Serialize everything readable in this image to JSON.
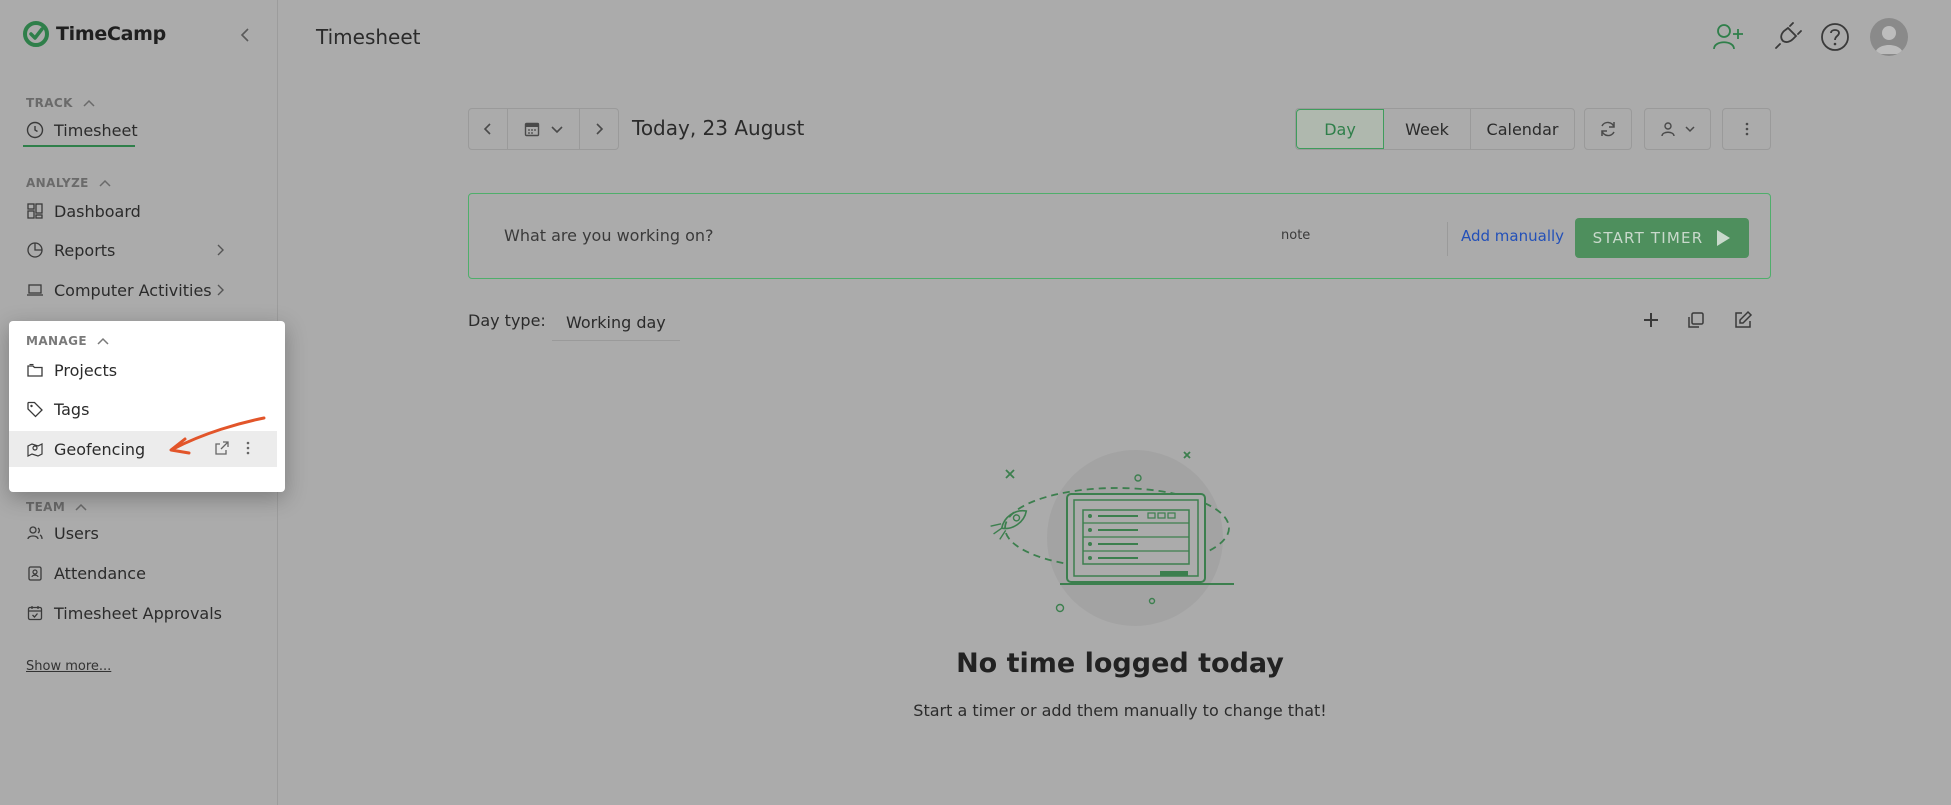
{
  "app": {
    "name": "TimeCamp"
  },
  "sidebar": {
    "track": {
      "label": "TRACK",
      "items": [
        {
          "label": "Timesheet"
        }
      ]
    },
    "analyze": {
      "label": "ANALYZE",
      "items": [
        {
          "label": "Dashboard"
        },
        {
          "label": "Reports"
        },
        {
          "label": "Computer Activities"
        }
      ]
    },
    "manage": {
      "label": "MANAGE",
      "items": [
        {
          "label": "Projects"
        },
        {
          "label": "Tags"
        },
        {
          "label": "Geofencing"
        }
      ]
    },
    "team": {
      "label": "TEAM",
      "items": [
        {
          "label": "Users"
        },
        {
          "label": "Attendance"
        },
        {
          "label": "Timesheet Approvals"
        }
      ]
    },
    "show_more": "Show more..."
  },
  "header": {
    "title": "Timesheet"
  },
  "date_nav": {
    "date_label": "Today, 23 August"
  },
  "views": {
    "day": "Day",
    "week": "Week",
    "calendar": "Calendar",
    "active": "Day"
  },
  "timer": {
    "placeholder": "What are you working on?",
    "note": "note",
    "add_manually": "Add manually",
    "start_label": "START TIMER"
  },
  "day_type": {
    "label": "Day type:",
    "value": "Working day"
  },
  "empty_state": {
    "title": "No time logged today",
    "subtitle": "Start a timer or add them manually to change that!"
  },
  "colors": {
    "brand_green": "#2f7f4a",
    "link_blue": "#2350b8",
    "annotation_arrow": "#e2552a"
  }
}
